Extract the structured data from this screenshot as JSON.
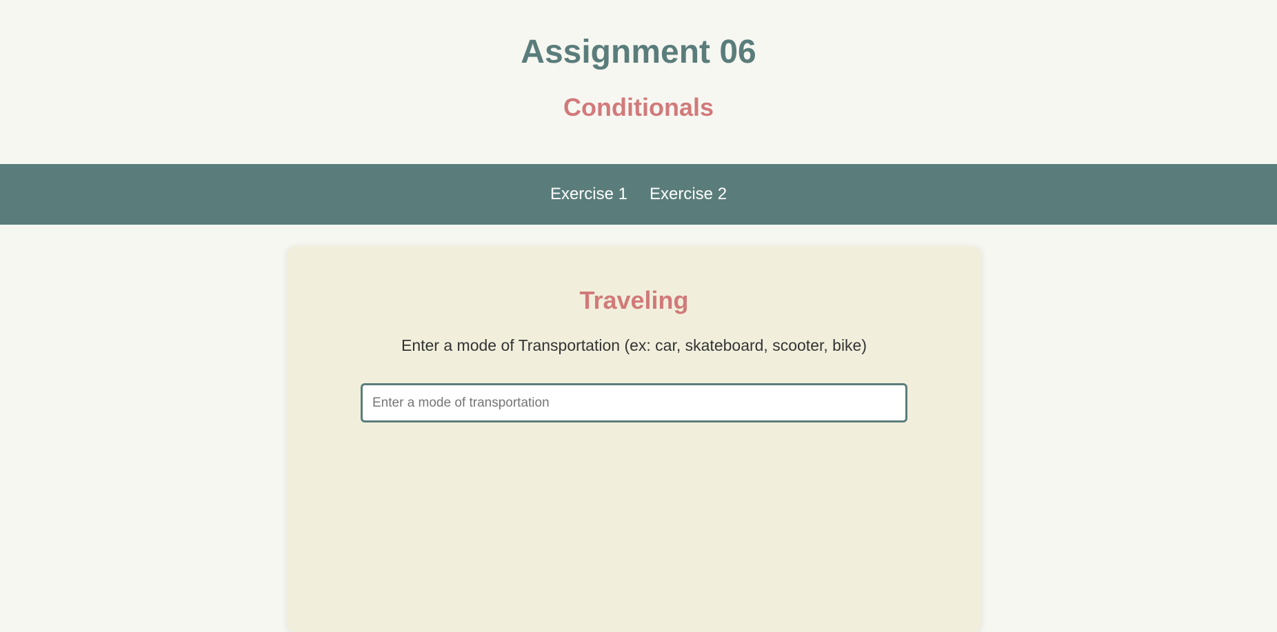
{
  "header": {
    "title": "Assignment 06",
    "subtitle": "Conditionals"
  },
  "nav": {
    "items": [
      {
        "label": "Exercise 1"
      },
      {
        "label": "Exercise 2"
      }
    ]
  },
  "card": {
    "title": "Traveling",
    "instruction": "Enter a mode of Transportation (ex: car, skateboard, scooter, bike)",
    "input": {
      "value": "",
      "placeholder": "Enter a mode of transportation"
    }
  },
  "colors": {
    "primary": "#5a7d7b",
    "accent": "#d17a7a",
    "background": "#f7f7f2",
    "card": "#f1efdc"
  }
}
